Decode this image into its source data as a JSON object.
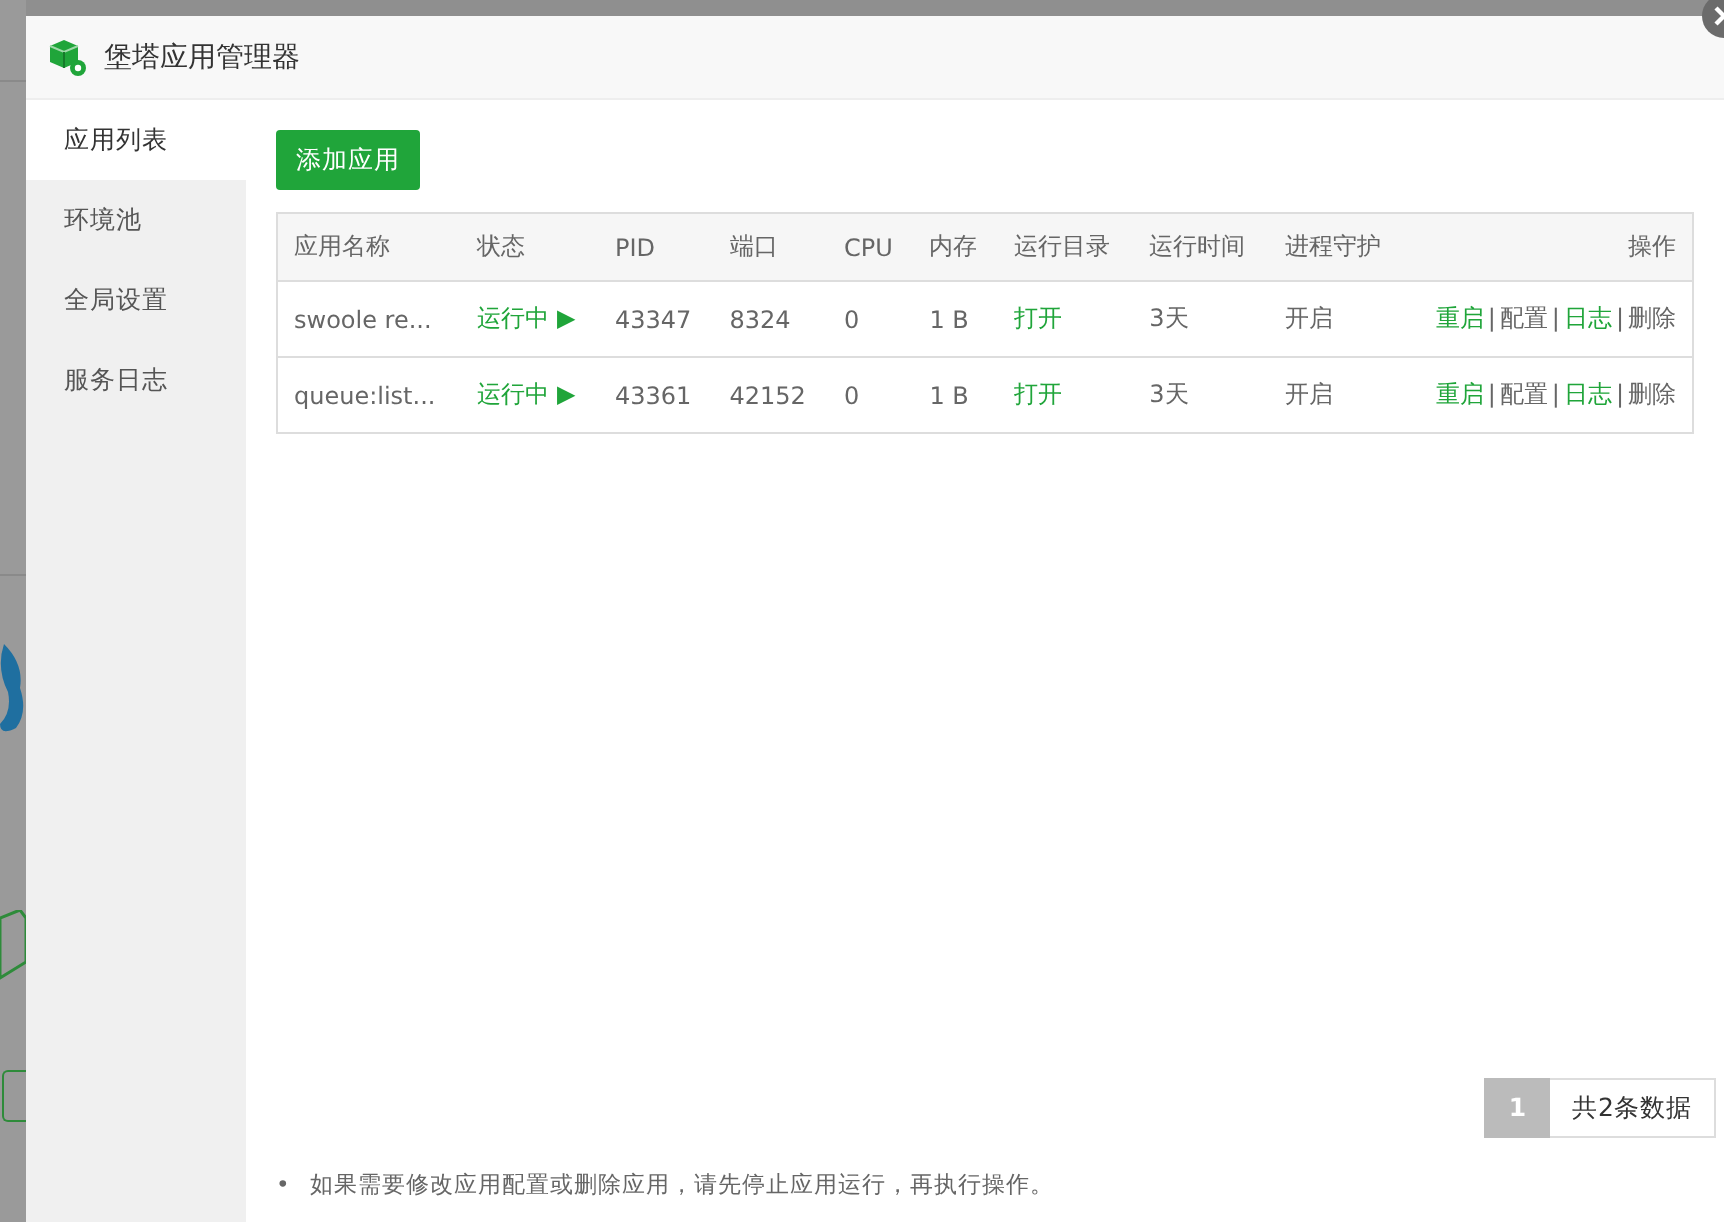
{
  "window": {
    "title": "堡塔应用管理器"
  },
  "sidebar": {
    "items": [
      {
        "label": "应用列表",
        "selected": true
      },
      {
        "label": "环境池",
        "selected": false
      },
      {
        "label": "全局设置",
        "selected": false
      },
      {
        "label": "服务日志",
        "selected": false
      }
    ]
  },
  "add_button": "添加应用",
  "table": {
    "columns": [
      "应用名称",
      "状态",
      "PID",
      "端口",
      "CPU",
      "内存",
      "运行目录",
      "运行时间",
      "进程守护",
      "操作"
    ],
    "rows": [
      {
        "name": "swoole re...",
        "status": "运行中 ▶",
        "running": true,
        "pid": "43347",
        "port": "8324",
        "cpu": "0",
        "memory": "1 B",
        "directory": "打开",
        "uptime": "3天",
        "daemon": "开启",
        "actions": [
          {
            "label": "重启",
            "kind": "link"
          },
          {
            "label": "|",
            "kind": "separator"
          },
          {
            "label": "配置",
            "kind": "plain"
          },
          {
            "label": "|",
            "kind": "separator"
          },
          {
            "label": "日志",
            "kind": "link"
          },
          {
            "label": "|",
            "kind": "separator"
          },
          {
            "label": "删除",
            "kind": "plain"
          }
        ]
      },
      {
        "name": "queue:list...",
        "status": "运行中 ▶",
        "running": true,
        "pid": "43361",
        "port": "42152",
        "cpu": "0",
        "memory": "1 B",
        "directory": "打开",
        "uptime": "3天",
        "daemon": "开启",
        "actions": [
          {
            "label": "重启",
            "kind": "link"
          },
          {
            "label": "|",
            "kind": "separator"
          },
          {
            "label": "配置",
            "kind": "plain"
          },
          {
            "label": "|",
            "kind": "separator"
          },
          {
            "label": "日志",
            "kind": "link"
          },
          {
            "label": "|",
            "kind": "separator"
          },
          {
            "label": "删除",
            "kind": "plain"
          }
        ]
      }
    ]
  },
  "pagination": {
    "pages": [
      {
        "label": "1",
        "selected": true
      }
    ],
    "summary": "共2条数据"
  },
  "note_bullet": "•",
  "notes": [
    "如果需要修改应用配置或删除应用，请先停止应用运行，再执行操作。"
  ]
}
